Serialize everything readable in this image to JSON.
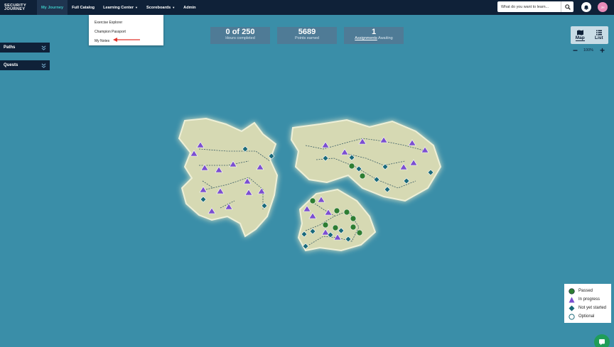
{
  "nav": {
    "logo_line1": "SECURITY",
    "logo_line2": "JOURNEY",
    "items": [
      {
        "label": "My Journey"
      },
      {
        "label": "Full Catalog"
      },
      {
        "label": "Learning Center"
      },
      {
        "label": "Scoreboards"
      },
      {
        "label": "Admin"
      }
    ],
    "search_placeholder": "What do you want to learn...",
    "avatar_initials": "JH"
  },
  "dropdown": {
    "items": [
      {
        "label": "Exercise Explorer"
      },
      {
        "label": "Champion Passport"
      },
      {
        "label": "My Notes"
      }
    ]
  },
  "stats": {
    "hours_value": "0 of 250",
    "hours_label": "Hours completed",
    "points_value": "5689",
    "points_label": "Points earned",
    "assignments_value": "1",
    "assignments_link": "Assignments",
    "assignments_label": " Awaiting"
  },
  "panels": {
    "paths": "Paths",
    "quests": "Quests"
  },
  "view": {
    "map_label": "Map",
    "list_label": "List",
    "zoom_level": "100%"
  },
  "legend": {
    "passed": "Passed",
    "in_progress": "In progress",
    "not_started": "Not yet started",
    "optional": "Optional"
  },
  "colors": {
    "ocean": "#3a8ea8",
    "nav": "#0f2138",
    "accent": "#3ec9c5",
    "passed": "#2e7d32",
    "in_progress": "#7b4fd0",
    "not_started": "#1a6a7a",
    "land": "#d8dcb6"
  }
}
